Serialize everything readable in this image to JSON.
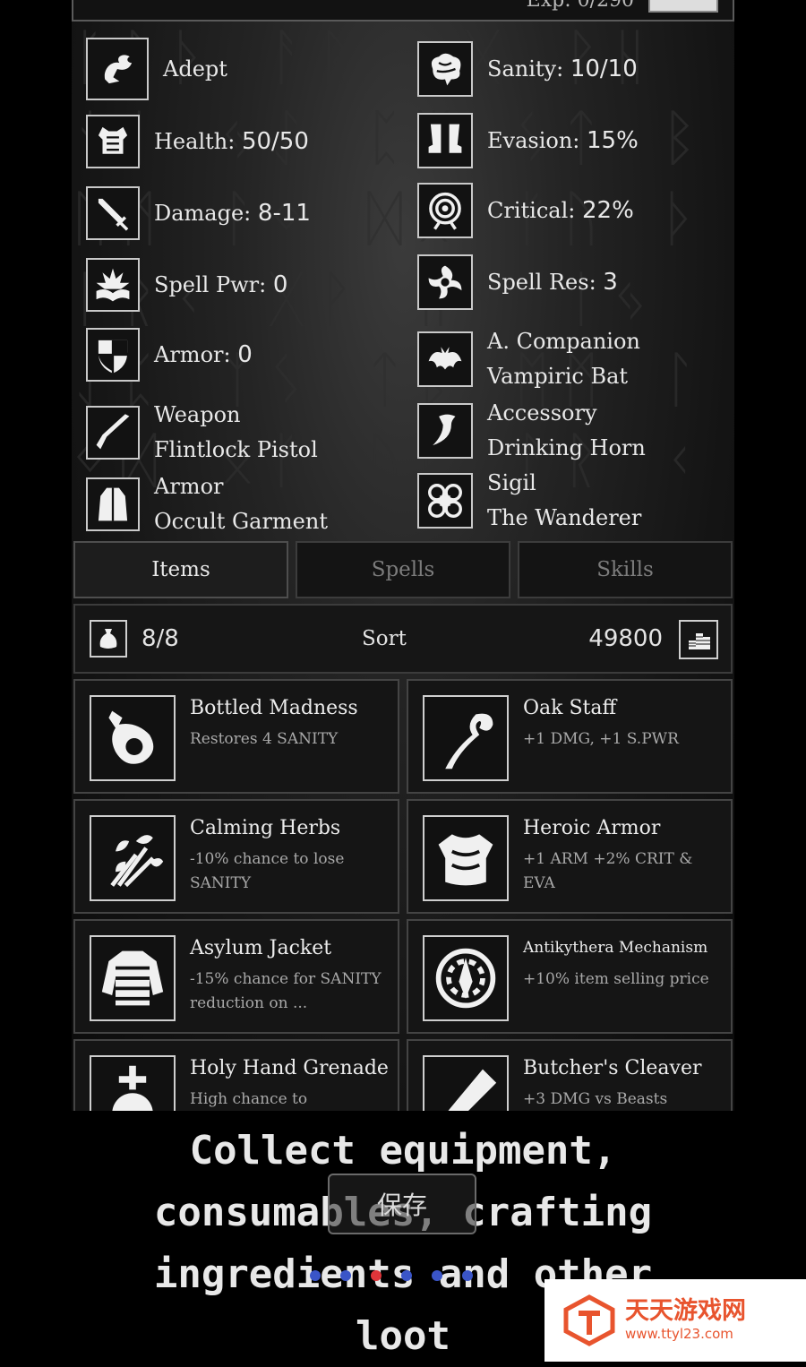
{
  "header": {
    "level_text": "Exp: 0/290"
  },
  "stats": {
    "left": [
      {
        "label": "Adept",
        "value": ""
      },
      {
        "label": "Health: ",
        "value": "50/50"
      },
      {
        "label": "Damage: ",
        "value": "8-11"
      },
      {
        "label": "Spell Pwr: ",
        "value": "0"
      },
      {
        "label": "Armor: ",
        "value": "0"
      },
      {
        "label": "Weapon",
        "value": "Flintlock Pistol"
      },
      {
        "label": "Armor",
        "value": "Occult Garment"
      }
    ],
    "right": [
      {
        "label": "Sanity: ",
        "value": "10/10"
      },
      {
        "label": "Evasion: ",
        "value": "15%"
      },
      {
        "label": "Critical: ",
        "value": "22%"
      },
      {
        "label": "Spell Res: ",
        "value": "3"
      },
      {
        "label": "A. Companion",
        "value": "Vampiric Bat"
      },
      {
        "label": "Accessory",
        "value": "Drinking Horn"
      },
      {
        "label": "Sigil",
        "value": "The Wanderer"
      }
    ]
  },
  "tabs": [
    {
      "label": "Items",
      "active": true
    },
    {
      "label": "Spells",
      "active": false
    },
    {
      "label": "Skills",
      "active": false
    }
  ],
  "inventory": {
    "capacity": "8/8",
    "sort_label": "Sort",
    "gold": "49800"
  },
  "items": [
    {
      "name": "Bottled Madness",
      "desc": "Restores 4 SANITY",
      "icon": "potion-icon"
    },
    {
      "name": "Oak Staff",
      "desc": "+1 DMG, +1 S.PWR",
      "icon": "staff-icon"
    },
    {
      "name": "Calming Herbs",
      "desc": "-10% chance to lose SANITY",
      "icon": "herbs-icon"
    },
    {
      "name": "Heroic Armor",
      "desc": "+1 ARM +2% CRIT & EVA",
      "icon": "armor-icon"
    },
    {
      "name": "Asylum Jacket",
      "desc": "-15% chance for SANITY reduction on ...",
      "icon": "jacket-icon"
    },
    {
      "name": "Antikythera Mechanism",
      "desc": "+10% item selling price",
      "icon": "mechanism-icon"
    },
    {
      "name": "Holy Hand Grenade",
      "desc": "High chance to",
      "icon": "grenade-icon"
    },
    {
      "name": "Butcher's Cleaver",
      "desc": "+3 DMG vs Beasts",
      "icon": "cleaver-icon"
    }
  ],
  "caption": {
    "line1": "Collect equipment,",
    "line2": "consumables, crafting",
    "line3": "ingredients and other",
    "line4": "loot"
  },
  "save_button": "保存",
  "pager": {
    "count": 6,
    "active_index": 2,
    "active_color": "#e0353a",
    "inactive_color": "#3a55c8"
  },
  "watermark": {
    "title": "天天游戏网",
    "url": "www.ttyl23.com"
  }
}
